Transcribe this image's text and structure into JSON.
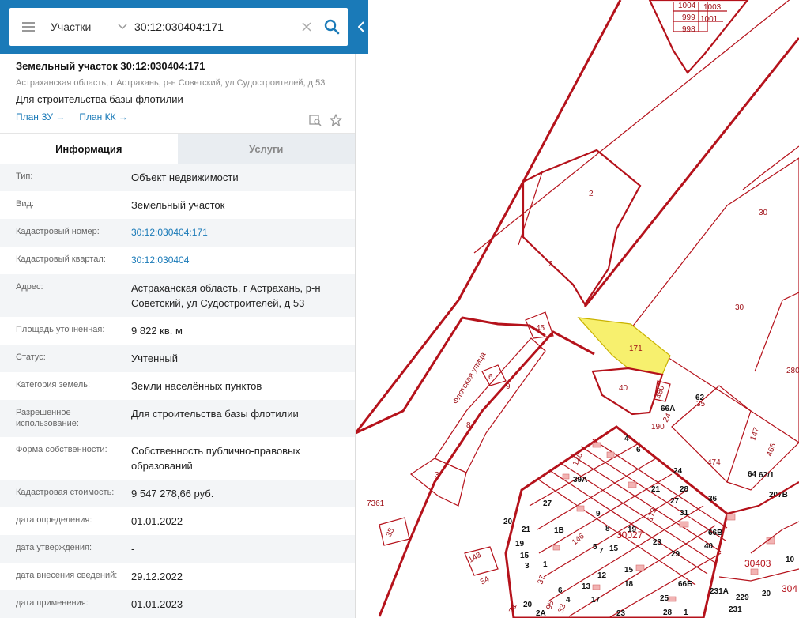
{
  "search": {
    "layer": "Участки",
    "value": "30:12:030404:171"
  },
  "object": {
    "title": "Земельный участок 30:12:030404:171",
    "address": "Астраханская область, г Астрахань, р-н Советский, ул Судостроителей, д 53",
    "purpose": "Для строительства базы флотилии",
    "plan_zu": "План ЗУ →",
    "plan_kk": "План КК →"
  },
  "tabs": {
    "info": "Информация",
    "services": "Услуги"
  },
  "rows": [
    {
      "k": "Тип:",
      "v": "Объект недвижимости"
    },
    {
      "k": "Вид:",
      "v": "Земельный участок"
    },
    {
      "k": "Кадастровый номер:",
      "v": "30:12:030404:171"
    },
    {
      "k": "Кадастровый квартал:",
      "v": "30:12:030404"
    },
    {
      "k": "Адрес:",
      "v": "Астраханская область, г Астрахань, р-н Советский, ул Судостроителей, д 53"
    },
    {
      "k": "Площадь уточненная:",
      "v": "9 822 кв. м"
    },
    {
      "k": "Статус:",
      "v": "Учтенный"
    },
    {
      "k": "Категория земель:",
      "v": "Земли населённых пунктов"
    },
    {
      "k": "Разрешенное использование:",
      "v": "Для строительства базы флотилии"
    },
    {
      "k": "Форма собственности:",
      "v": "Собственность публично-правовых образований"
    },
    {
      "k": "Кадастровая стоимость:",
      "v": "9 547 278,66 руб."
    },
    {
      "k": "дата определения:",
      "v": "01.01.2022"
    },
    {
      "k": "дата утверждения:",
      "v": "-"
    },
    {
      "k": "дата внесения сведений:",
      "v": "29.12.2022"
    },
    {
      "k": "дата применения:",
      "v": "01.01.2023"
    }
  ],
  "map": {
    "street": "Флотская улица",
    "selected_parcel": "171",
    "parcels": [
      "1004",
      "1003",
      "999",
      "1001",
      "998",
      "2",
      "2",
      "30",
      "30",
      "45",
      "6",
      "9",
      "40",
      "480",
      "62",
      "66А",
      "35",
      "8",
      "190",
      "24",
      "474",
      "3",
      "147",
      "466",
      "64",
      "62/1",
      "207В",
      "7361",
      "20",
      "4",
      "6",
      "24",
      "126",
      "39А",
      "27",
      "21",
      "28",
      "36",
      "27",
      "31",
      "9",
      "173",
      "8",
      "19",
      "1В",
      "21",
      "146",
      "66В",
      "30027",
      "23",
      "19",
      "15",
      "40",
      "29",
      "5",
      "7",
      "15",
      "3",
      "1",
      "143",
      "35",
      "54",
      "12",
      "15",
      "30403",
      "10",
      "13",
      "18",
      "66Б",
      "37",
      "6",
      "231А",
      "229",
      "20",
      "304",
      "20",
      "25",
      "4",
      "17",
      "2А",
      "23",
      "28",
      "231",
      "1",
      "71",
      "95",
      "33",
      "280"
    ],
    "accent": "#f5ef6b"
  }
}
